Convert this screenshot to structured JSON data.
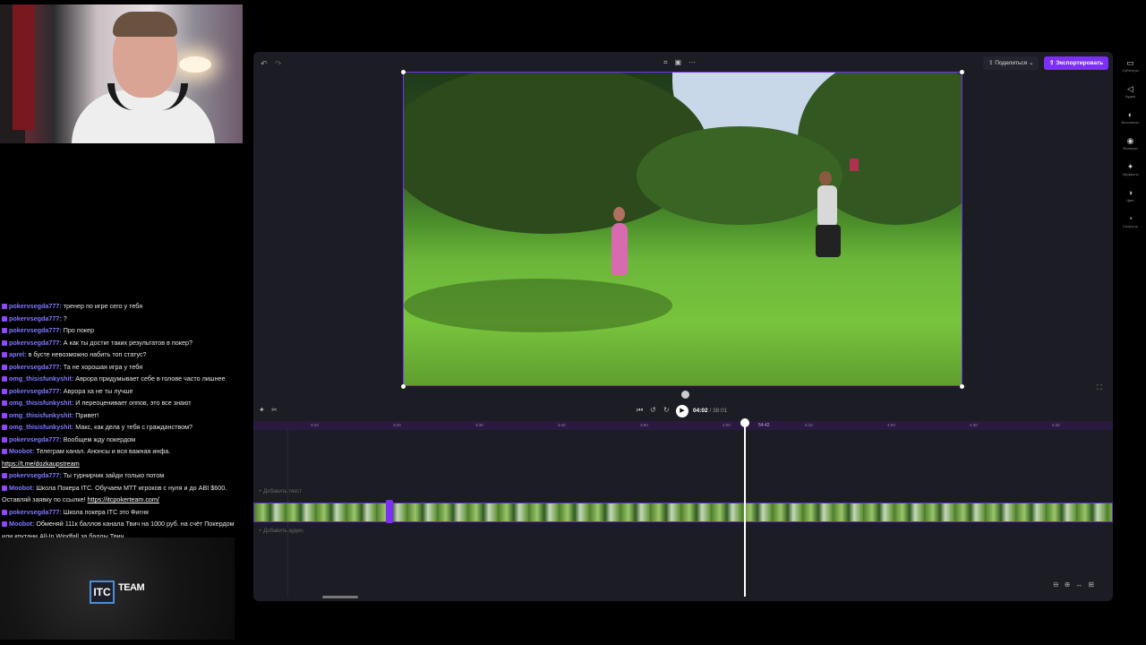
{
  "chat": [
    {
      "user": "pokervsegda777:",
      "text": "тренер по игре сего у тебя",
      "link": ""
    },
    {
      "user": "pokervsegda777:",
      "text": "?",
      "link": ""
    },
    {
      "user": "pokervsegda777:",
      "text": "Про покер",
      "link": ""
    },
    {
      "user": "pokervsegda777:",
      "text": "А как ты достиг таких результатов в покер?",
      "link": ""
    },
    {
      "user": "aprel:",
      "text": "в бусте невозможно набить топ статус?",
      "link": ""
    },
    {
      "user": "pokervsegda777:",
      "text": "Та не хорошая игра у тебя",
      "link": ""
    },
    {
      "user": "omg_thisisfunkyshit:",
      "text": "Аврора придумывает себе в голове часто лишнее",
      "link": ""
    },
    {
      "user": "pokervsegda777:",
      "text": "Аврора ха не ты лучше",
      "link": ""
    },
    {
      "user": "omg_thisisfunkyshit:",
      "text": "И переоценивает оппов, это все знают",
      "link": ""
    },
    {
      "user": "omg_thisisfunkyshit:",
      "text": "Привет!",
      "link": ""
    },
    {
      "user": "omg_thisisfunkyshit:",
      "text": "Макс, как дела у тебя с гражданством?",
      "link": ""
    },
    {
      "user": "pokervsegda777:",
      "text": "Вообщем жду покердом",
      "link": ""
    },
    {
      "user": "Moobot:",
      "text": "Телеграм канал. Анонсы и вся важная инфа.",
      "link": "https://t.me/dozkaupstream"
    },
    {
      "user": "pokervsegda777:",
      "text": "Ты турнирчик зайди только потом",
      "link": ""
    },
    {
      "user": "Moobot:",
      "text": "Школа Покера ITC. Обучаем МТТ игроков с нуля и до ABI $600. Оставляй заявку по ссылке!",
      "link": "https://itcpokerteam.com/"
    },
    {
      "user": "pokervsegda777:",
      "text": "Школа покера ITC это Фигня",
      "link": ""
    },
    {
      "user": "Moobot:",
      "text": "Обменяй 111к баллов канала Твич на 1000 руб. на счёт Покердом или крутани All-In Windfall за баллы Твич.",
      "link": ""
    }
  ],
  "logo": {
    "itc": "ITC",
    "team": "TEAM"
  },
  "editor": {
    "share_label": "Поделиться",
    "export_label": "Экспортировать",
    "time_current": "04:02",
    "time_total": "/ 38:01",
    "add_text": "+ Добавить текст",
    "add_audio": "+ Добавить аудио",
    "playhead_label": "54:42"
  },
  "ruler_ticks": [
    "3:10",
    "3:20",
    "3:30",
    "3:40",
    "3:50",
    "4:00",
    "4:10",
    "4:20",
    "4:30",
    "4:40"
  ],
  "sidebar": [
    {
      "icon": "cc-icon",
      "glyph": "▭",
      "label": "Субтитры"
    },
    {
      "icon": "audio-icon",
      "glyph": "◁",
      "label": "Аудио"
    },
    {
      "icon": "fade-icon",
      "glyph": "◐",
      "label": "Бесплатно"
    },
    {
      "icon": "filters-icon",
      "glyph": "◉",
      "label": "Фильтры"
    },
    {
      "icon": "effects-icon",
      "glyph": "✦",
      "label": "Эффекты"
    },
    {
      "icon": "color-icon",
      "glyph": "◑",
      "label": "Цвет"
    },
    {
      "icon": "speed-icon",
      "glyph": "◔",
      "label": "Скорость"
    }
  ],
  "colors": {
    "accent": "#7b2ff7",
    "chat_user": "#7f78ff",
    "editor_bg": "#1c1c24"
  }
}
